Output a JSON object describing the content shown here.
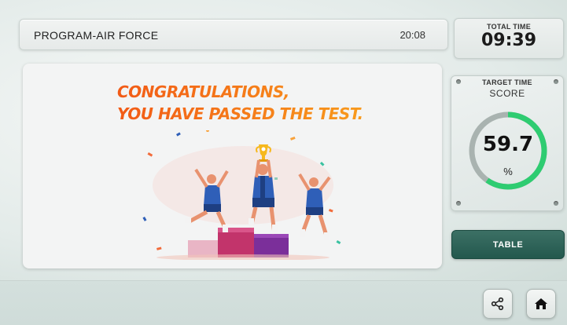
{
  "header": {
    "program_title": "PROGRAM-AIR FORCE",
    "clock": "20:08"
  },
  "total_time": {
    "label": "TOTAL TIME",
    "value": "09:39"
  },
  "result": {
    "line1": "CONGRATULATIONS,",
    "line2": "YOU HAVE PASSED THE TEST."
  },
  "score": {
    "target_label": "TARGET TIME",
    "label": "SCORE",
    "value": "59.7",
    "unit": "%",
    "gauge_fraction": 0.597,
    "gauge_color": "#2ecc71",
    "track_color": "#a9b3b0"
  },
  "actions": {
    "table_label": "TABLE",
    "share_icon": "share-icon",
    "home_icon": "home-icon"
  },
  "colors": {
    "accent_dark": "#23584d",
    "congrats_orange": "#f25a16"
  }
}
